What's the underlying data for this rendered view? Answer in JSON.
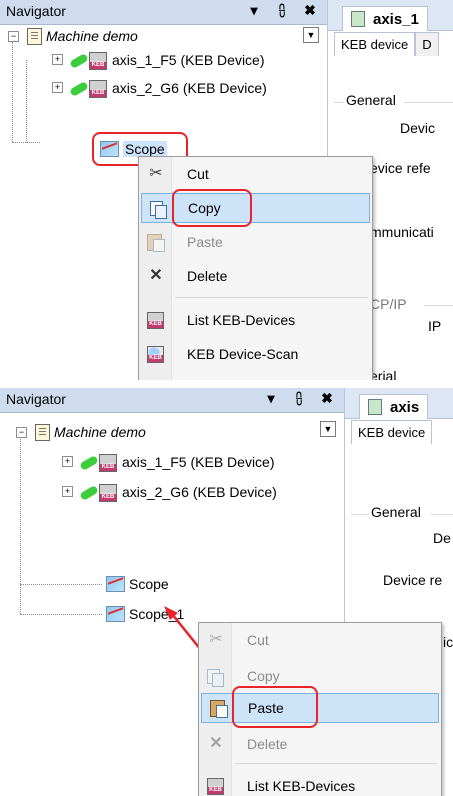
{
  "panel1": {
    "navigator": {
      "title": "Navigator",
      "header_icons": [
        "▾",
        "⩉",
        "✖"
      ],
      "project": "Machine demo",
      "devices": [
        "axis_1_F5 (KEB Device)",
        "axis_2_G6 (KEB Device)"
      ],
      "items": [
        "Scope"
      ]
    },
    "device_panel": {
      "tab_title": "axis_1",
      "subtab_active": "KEB device",
      "subtab_inactive": "D",
      "group_general": "General",
      "label_devi": "Devic",
      "label_device_ref": "evice refe",
      "label_communication": "mmunicati",
      "label_tcpip": "CP/IP",
      "label_ip": "IP",
      "label_serial": "erial"
    },
    "context_menu": {
      "items": [
        {
          "label": "Cut",
          "icon": "scissors-icon",
          "state": "normal"
        },
        {
          "label": "Copy",
          "icon": "copy-icon",
          "state": "highlighted"
        },
        {
          "label": "Paste",
          "icon": "paste-icon",
          "state": "disabled"
        },
        {
          "label": "Delete",
          "icon": "delete-icon",
          "state": "normal"
        },
        {
          "label": "List KEB-Devices",
          "icon": "list-keb-devices-icon",
          "state": "normal"
        },
        {
          "label": "KEB Device-Scan",
          "icon": "keb-device-scan-icon",
          "state": "normal"
        }
      ]
    }
  },
  "panel2": {
    "navigator": {
      "title": "Navigator",
      "header_icons": [
        "▾",
        "⩉",
        "✖"
      ],
      "project": "Machine demo",
      "devices": [
        "axis_1_F5 (KEB Device)",
        "axis_2_G6 (KEB Device)"
      ],
      "items": [
        "Scope",
        "Scope_1"
      ]
    },
    "device_panel": {
      "tab_title": "axis",
      "subtab_active": "KEB device",
      "group_general": "General",
      "label_de": "De",
      "label_device_re": "Device re",
      "label_ic": "ic"
    },
    "context_menu": {
      "items": [
        {
          "label": "Cut",
          "icon": "scissors-icon",
          "state": "disabled"
        },
        {
          "label": "Copy",
          "icon": "copy-icon",
          "state": "disabled"
        },
        {
          "label": "Paste",
          "icon": "paste-icon",
          "state": "highlighted"
        },
        {
          "label": "Delete",
          "icon": "delete-icon",
          "state": "disabled"
        },
        {
          "label": "List KEB-Devices",
          "icon": "list-keb-devices-icon",
          "state": "normal"
        }
      ]
    }
  },
  "colors": {
    "annotation_red": "#e8242a",
    "highlight_blue": "#cde3f8",
    "header_blue": "#cfdcee"
  }
}
